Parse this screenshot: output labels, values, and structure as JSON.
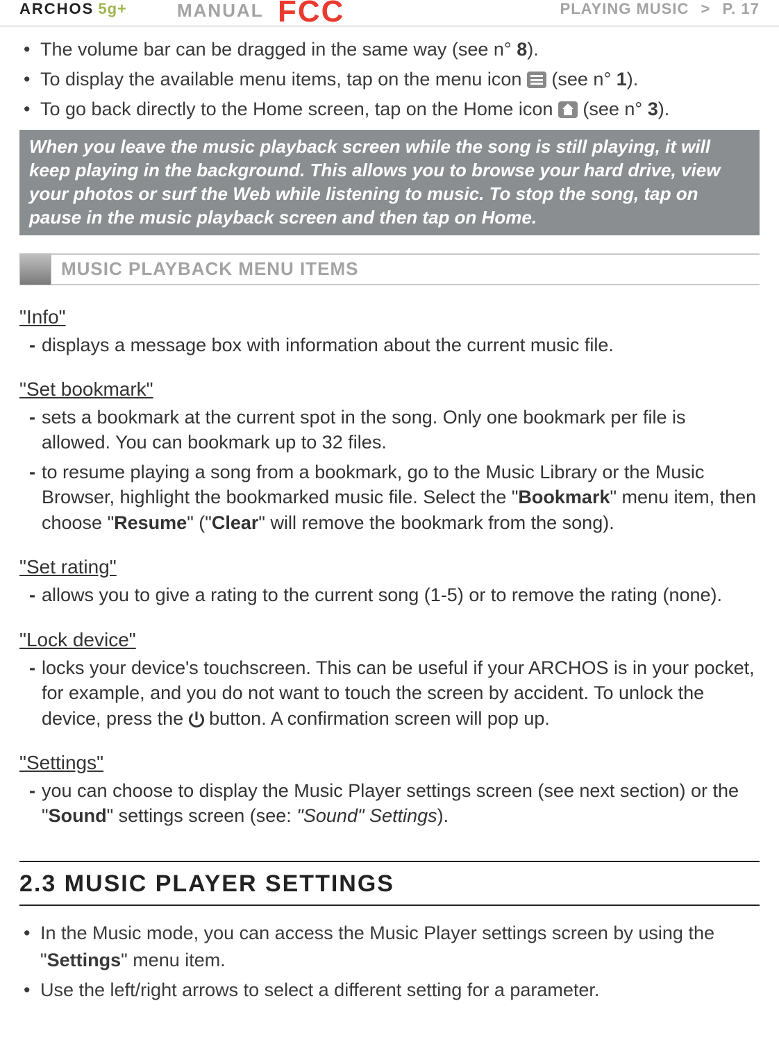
{
  "header": {
    "brand": "ARCHOS",
    "brand_suffix": "5g+",
    "manual": "MANUAL",
    "fcc": "FCC",
    "section": "PLAYING MUSIC",
    "sep": ">",
    "page": "P. 17"
  },
  "top_bullets": {
    "b1_a": "The volume bar can be dragged in the same way (see n° ",
    "b1_num": "8",
    "b1_b": ").",
    "b2_a": "To display the available menu items, tap on the menu icon ",
    "b2_b": " (see n° ",
    "b2_num": "1",
    "b2_c": ").",
    "b3_a": "To go back directly to the Home screen, tap on the Home icon ",
    "b3_b": " (see n° ",
    "b3_num": "3",
    "b3_c": ")."
  },
  "gray_note": "When you leave the music playback screen while the song is still playing, it will keep playing in the background. This allows you to browse your hard drive, view your photos or surf the Web while listening to music. To stop the song, tap on pause in the music playback screen and then tap on Home.",
  "band_title": "MUSIC PLAYBACK MENU ITEMS",
  "items": {
    "info": {
      "title": "\"Info\"",
      "d1": "displays a message box with information about the current music file."
    },
    "set_bookmark": {
      "title": "\"Set bookmark\"",
      "d1": "sets a bookmark at the current spot in the song. Only one bookmark per file is allowed. You can bookmark up to 32 files.",
      "d2_a": "to resume playing a song from a bookmark, go to the Music Library or the Music Browser, highlight the bookmarked music file. Select the \"",
      "d2_bold1": "Bookmark",
      "d2_b": "\" menu item, then choose \"",
      "d2_bold2": "Resume",
      "d2_c": "\" (\"",
      "d2_bold3": "Clear",
      "d2_d": "\" will remove the bookmark from the song)."
    },
    "set_rating": {
      "title": "\"Set rating\"",
      "d1": "allows you to give a rating to the current song (1-5) or to remove the rating (none)."
    },
    "lock_device": {
      "title": "\"Lock device\"",
      "d1_a": "locks your device's touchscreen. This can be useful if your ARCHOS is in your pocket, for example, and you do not want to touch the screen by accident. To unlock the device, press the ",
      "d1_b": " button. A confirmation screen will pop up."
    },
    "settings": {
      "title": "\"Settings\"",
      "d1_a": "you can choose to display the Music Player settings screen (see next section) or the \"",
      "d1_bold": "Sound",
      "d1_b": "\" settings screen (see: ",
      "d1_italic": "\"Sound\" Settings",
      "d1_c": ")."
    }
  },
  "big_heading": "2.3 MUSIC PLAYER SETTINGS",
  "bottom_bullets": {
    "b1_a": "In the Music mode, you can access the Music Player settings screen by using the \"",
    "b1_bold": "Settings",
    "b1_b": "\" menu item.",
    "b2": "Use the left/right arrows to select a different setting for a parameter."
  }
}
